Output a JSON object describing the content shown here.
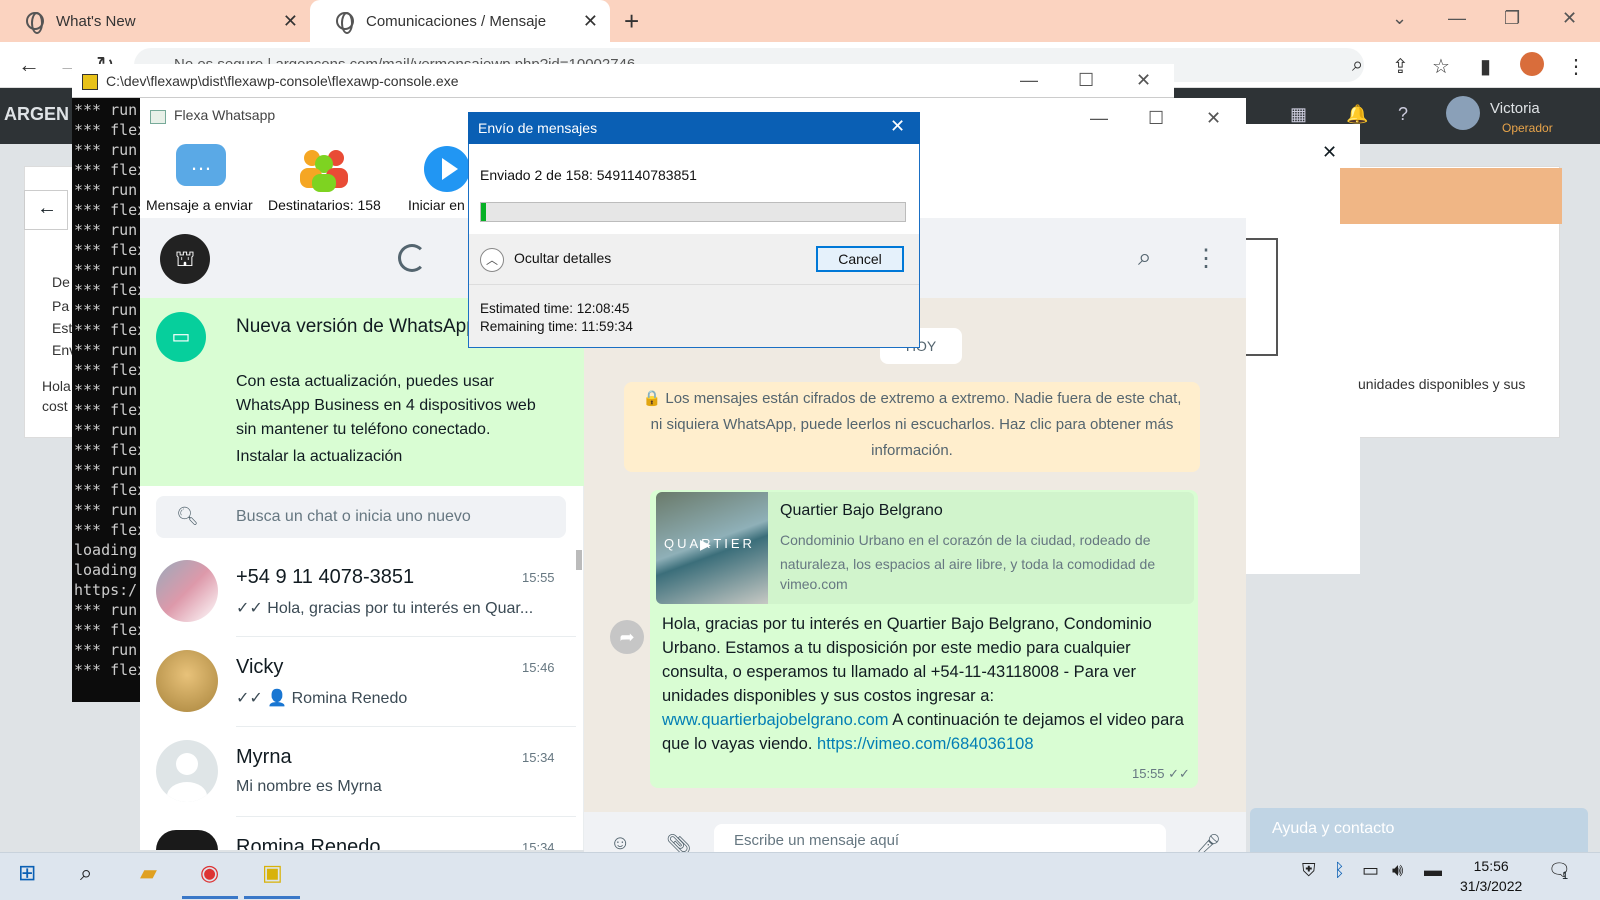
{
  "browser": {
    "tabs": [
      {
        "label": "What's New"
      },
      {
        "label": "Comunicaciones / Mensaje"
      }
    ],
    "url": "No es seguro | argencons.com/mail/vermensajewp.php?id=10002746"
  },
  "webpage": {
    "brand": "ARGEN",
    "user_name": "Victoria",
    "user_role": "Operador",
    "field_labels": [
      "De",
      "Pa",
      "Est",
      "Env"
    ],
    "body_preview": "Hola",
    "body_preview2": "cost",
    "right_text": "unidades disponibles y sus",
    "help_label": "Ayuda y contacto"
  },
  "console": {
    "title": "C:\\dev\\flexawp\\dist\\flexawp-console\\flexawp-console.exe",
    "lines": [
      "*** run",
      "*** flex",
      "*** run",
      "*** flex",
      "*** run",
      "*** flex",
      "*** run",
      "*** flex",
      "*** run",
      "*** flex",
      "*** run",
      "*** flex",
      "*** run",
      "*** flex",
      "*** run",
      "*** flex",
      "*** run",
      "*** flex",
      "*** run",
      "*** flex",
      "*** run",
      "*** flex",
      "loading",
      "loading",
      "https:/",
      "*** run",
      "*** flex",
      "*** run",
      "*** flex"
    ]
  },
  "flexa": {
    "title": "Flexa Whatsapp",
    "toolbar": {
      "message_label": "Mensaje a enviar",
      "recipients_label": "Destinatarios: 158",
      "start_label": "Iniciar en"
    }
  },
  "whatsapp": {
    "update": {
      "title": "Nueva versión de WhatsApp disponible",
      "body": "Con esta actualización, puedes usar WhatsApp Business en 4 dispositivos web sin mantener tu teléfono conectado.",
      "link": "Instalar la actualización"
    },
    "search_placeholder": "Busca un chat o inicia uno nuevo",
    "chats": [
      {
        "name": "+54 9 11 4078-3851",
        "time": "15:55",
        "message": "✓✓ Hola, gracias por tu interés en Quar..."
      },
      {
        "name": "Vicky",
        "time": "15:46",
        "message": "✓✓ 👤 Romina Renedo"
      },
      {
        "name": "Myrna",
        "time": "15:34",
        "message": "Mi nombre es Myrna"
      },
      {
        "name": "Romina Renedo",
        "time": "15:34",
        "message": ""
      }
    ],
    "day_label": "HOY",
    "encryption_notice": "🔒 Los mensajes están cifrados de extremo a extremo. Nadie fuera de este chat, ni siquiera WhatsApp, puede leerlos ni escucharlos. Haz clic para obtener más información.",
    "preview": {
      "title": "Quartier Bajo Belgrano",
      "description": "Condominio Urbano en el corazón de la ciudad, rodeado de naturaleza, los espacios al aire libre, y toda la comodidad de",
      "domain": "vimeo.com",
      "thumb_text": "QUARTIER"
    },
    "message": {
      "text_part1": "Hola, gracias por tu interés en Quartier Bajo Belgrano, Condominio Urbano. Estamos a tu disposición por este medio para cualquier consulta, o esperamos tu llamado al +54-11-43118008  - Para ver unidades disponibles y sus costos ingresar a:",
      "link1": "www.quartierbajobelgrano.com",
      "text_part2": " A continuación te dejamos el video para que lo vayas viendo. ",
      "link2": "https://vimeo.com/684036108",
      "time": "15:55 ✓✓"
    },
    "compose_placeholder": "Escribe un mensaje aquí"
  },
  "dialog": {
    "title": "Envío de mensajes",
    "sent_text": "Enviado 2 de 158: 5491140783851",
    "progress": 0.0127,
    "hide_details": "Ocultar detalles",
    "cancel_label": "Cancel",
    "estimated": "Estimated time: 12:08:45",
    "remaining": "Remaining time: 11:59:34"
  },
  "taskbar": {
    "time": "15:56",
    "date": "31/3/2022",
    "notification_count": "1"
  },
  "colors": {
    "accent": "#0a5fb4",
    "progress": "#06b025",
    "whatsapp_green": "#d9fdd3",
    "link": "#027eb5"
  }
}
